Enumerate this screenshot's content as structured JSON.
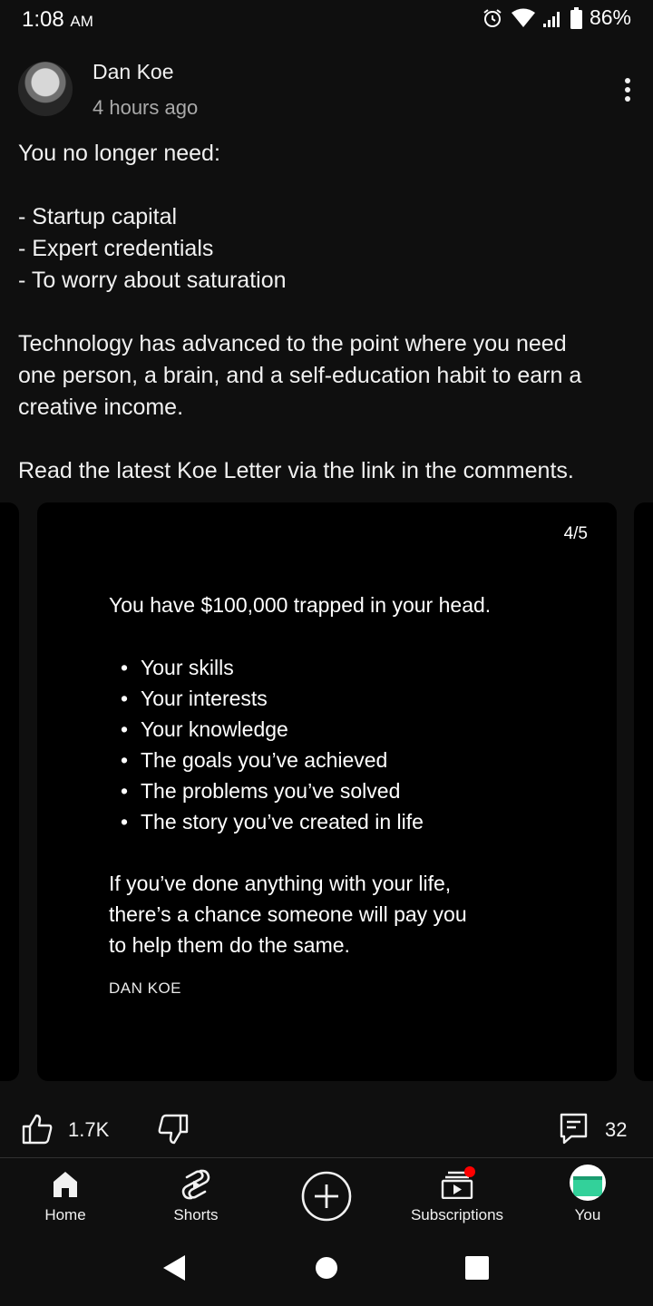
{
  "status_bar": {
    "time": "1:08",
    "ampm": "AM",
    "battery": "86%"
  },
  "post": {
    "author": "Dan Koe",
    "time_ago": "4 hours ago",
    "text_lines": [
      "You no longer need:",
      "- Startup capital",
      "- Expert credentials",
      "- To worry about saturation",
      "Technology has advanced to the point where you need",
      "one person, a brain, and a self-education habit to earn a",
      "creative income.",
      "Read the latest Koe Letter via the link in the comments."
    ]
  },
  "image_card": {
    "page_indicator": "4/5",
    "headline": "You have $100,000 trapped in your head.",
    "bullets": [
      "Your skills",
      "Your interests",
      "Your knowledge",
      "The goals you’ve achieved",
      "The problems you’ve solved",
      "The story you’ve created in life"
    ],
    "closing_lines": [
      "If you’ve done anything with your life,",
      "there’s a chance someone will pay you",
      "to help them do the same."
    ],
    "signature": "DAN KOE"
  },
  "actions": {
    "like_count": "1.7K",
    "comment_count": "32"
  },
  "bottom_nav": {
    "items": [
      {
        "label": "Home",
        "icon": "home-icon"
      },
      {
        "label": "Shorts",
        "icon": "shorts-icon"
      },
      {
        "label": "",
        "icon": "create-icon"
      },
      {
        "label": "Subscriptions",
        "icon": "subscriptions-icon"
      },
      {
        "label": "You",
        "icon": "you-avatar-icon"
      }
    ]
  },
  "colors": {
    "background": "#0f0f0f",
    "secondary_text": "#aaaaaa",
    "notification_dot": "#ff0000"
  }
}
